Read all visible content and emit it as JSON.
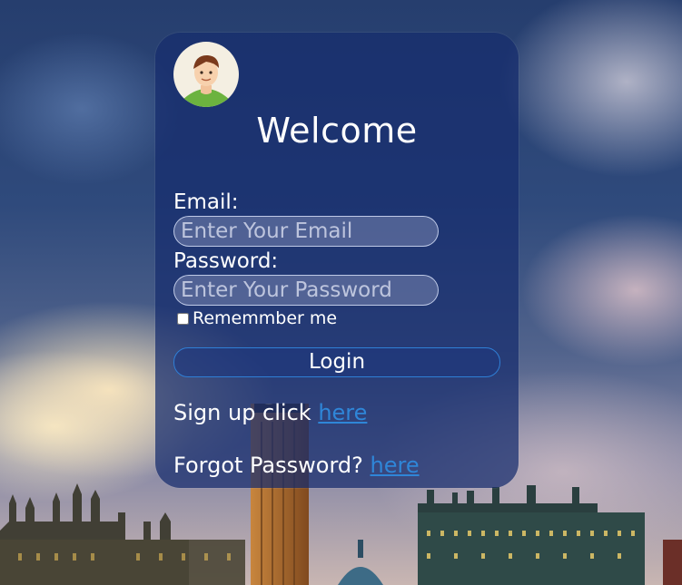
{
  "form": {
    "title": "Welcome",
    "email_label": "Email:",
    "email_placeholder": "Enter Your Email",
    "password_label": "Password:",
    "password_placeholder": "Enter Your Password",
    "remember_label": "Rememmber me",
    "login_label": "Login",
    "signup_text": "Sign up click",
    "signup_link": "here",
    "forgot_text": "Forgot Password?",
    "forgot_link": "here"
  },
  "icons": {
    "avatar": "user-avatar-icon"
  },
  "colors": {
    "card_bg": "#162c6e",
    "link": "#2f86d8",
    "login_border": "#2f7fd6"
  }
}
